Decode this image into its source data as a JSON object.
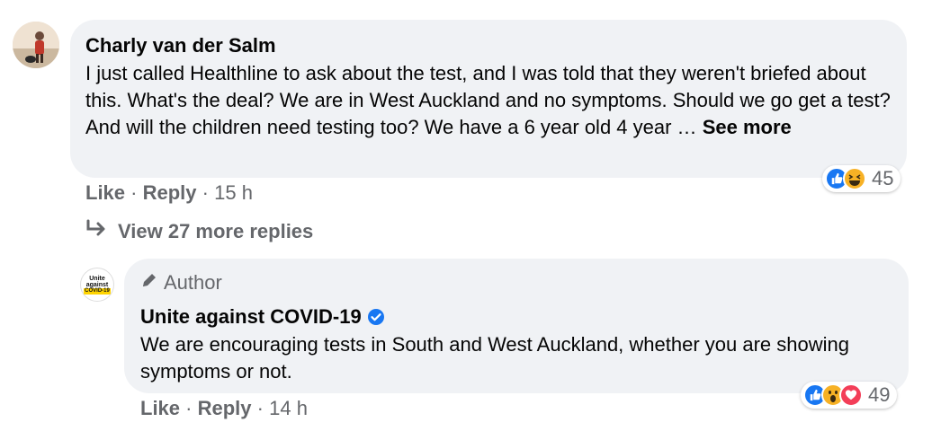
{
  "comment": {
    "author": "Charly van der Salm",
    "text": "I just called Healthline to ask about the test, and I was told that they weren't briefed about this. What's the deal? We are in West Auckland and no symptoms. Should we go get a test? And will the children need testing too? We have a 6 year old 4 year …",
    "see_more": "See more",
    "reaction_count": "45",
    "reactions": [
      "like-icon",
      "haha-icon"
    ],
    "actions": {
      "like": "Like",
      "reply": "Reply",
      "time": "15 h",
      "sep": "·"
    }
  },
  "view_replies": "View 27 more replies",
  "reply": {
    "badge": "Author",
    "author": "Unite against COVID-19",
    "verified": true,
    "text": "We are encouraging tests in South and West Auckland, whether you are showing symptoms or not.",
    "reaction_count": "49",
    "reactions": [
      "like-icon",
      "wow-icon",
      "love-icon"
    ],
    "actions": {
      "like": "Like",
      "reply": "Reply",
      "time": "14 h",
      "sep": "·"
    },
    "avatar_text": [
      "Unite",
      "against",
      "COVID-19"
    ]
  },
  "colors": {
    "bubble": "#f0f2f5",
    "secondary_text": "#65676b",
    "like_blue": "#1877f2",
    "love_red": "#f33e58",
    "haha_yellow": "#f7b125",
    "covid_yellow": "#ffd400"
  }
}
